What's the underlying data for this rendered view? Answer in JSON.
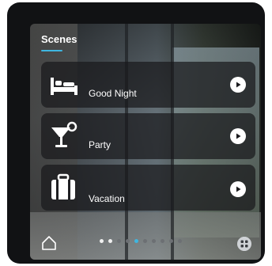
{
  "header": {
    "title": "Scenes"
  },
  "scenes": [
    {
      "label": "Good Night",
      "icon": "bed-icon"
    },
    {
      "label": "Party",
      "icon": "cocktail-icon"
    },
    {
      "label": "Vacation",
      "icon": "suitcase-icon"
    }
  ],
  "pager": {
    "total": 10,
    "active_index": 4
  },
  "colors": {
    "accent": "#3fb6e0",
    "card_bg": "rgba(25,25,28,0.72)"
  }
}
